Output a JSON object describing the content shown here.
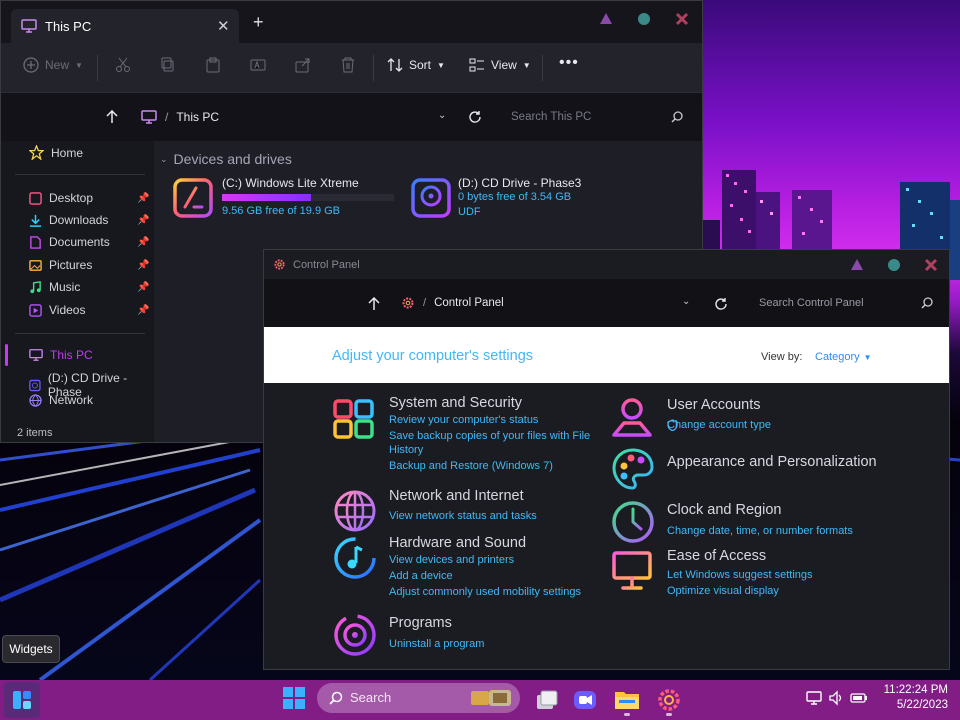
{
  "explorer": {
    "tab_title": "This PC",
    "toolbar": {
      "new_label": "New",
      "sort_label": "Sort",
      "view_label": "View"
    },
    "breadcrumb": "This PC",
    "search_placeholder": "Search This PC",
    "nav": {
      "home": "Home",
      "desktop": "Desktop",
      "downloads": "Downloads",
      "documents": "Documents",
      "pictures": "Pictures",
      "music": "Music",
      "videos": "Videos",
      "this_pc": "This PC",
      "cd_drive": "(D:) CD Drive - Phase",
      "network": "Network"
    },
    "status": "2 items",
    "section_title": "Devices and drives",
    "drives": [
      {
        "name": "(C:) Windows Lite Xtreme",
        "free": "9.56 GB free of 19.9 GB",
        "used_fraction": 0.52
      },
      {
        "name": "(D:) CD Drive - Phase3",
        "free": "0 bytes free of 3.54 GB",
        "fs": "UDF"
      }
    ]
  },
  "control_panel": {
    "title": "Control Panel",
    "breadcrumb": "Control Panel",
    "search_placeholder": "Search Control Panel",
    "heading": "Adjust your computer's settings",
    "view_by_label": "View by:",
    "view_by_value": "Category",
    "categories": {
      "system": {
        "title": "System and Security",
        "links": [
          "Review your computer's status",
          "Save backup copies of your files with File",
          "History",
          "Backup and Restore (Windows 7)"
        ]
      },
      "network": {
        "title": "Network and Internet",
        "links": [
          "View network status and tasks"
        ]
      },
      "hardware": {
        "title": "Hardware and Sound",
        "links": [
          "View devices and printers",
          "Add a device",
          "Adjust commonly used mobility settings"
        ]
      },
      "programs": {
        "title": "Programs",
        "links": [
          "Uninstall a program"
        ]
      },
      "user": {
        "title": "User Accounts",
        "links": [
          "Change account type"
        ]
      },
      "appearance": {
        "title": "Appearance and Personalization",
        "links": []
      },
      "clock": {
        "title": "Clock and Region",
        "links": [
          "Change date, time, or number formats"
        ]
      },
      "ease": {
        "title": "Ease of Access",
        "links": [
          "Let Windows suggest settings",
          "Optimize visual display"
        ]
      }
    }
  },
  "taskbar": {
    "search_label": "Search",
    "time": "11:22:24 PM",
    "date": "5/22/2023"
  },
  "tooltip": "Widgets",
  "colors": {
    "link": "#42b8f5",
    "taskbar": "#831d86",
    "accent_purple": "#c23cf0"
  }
}
